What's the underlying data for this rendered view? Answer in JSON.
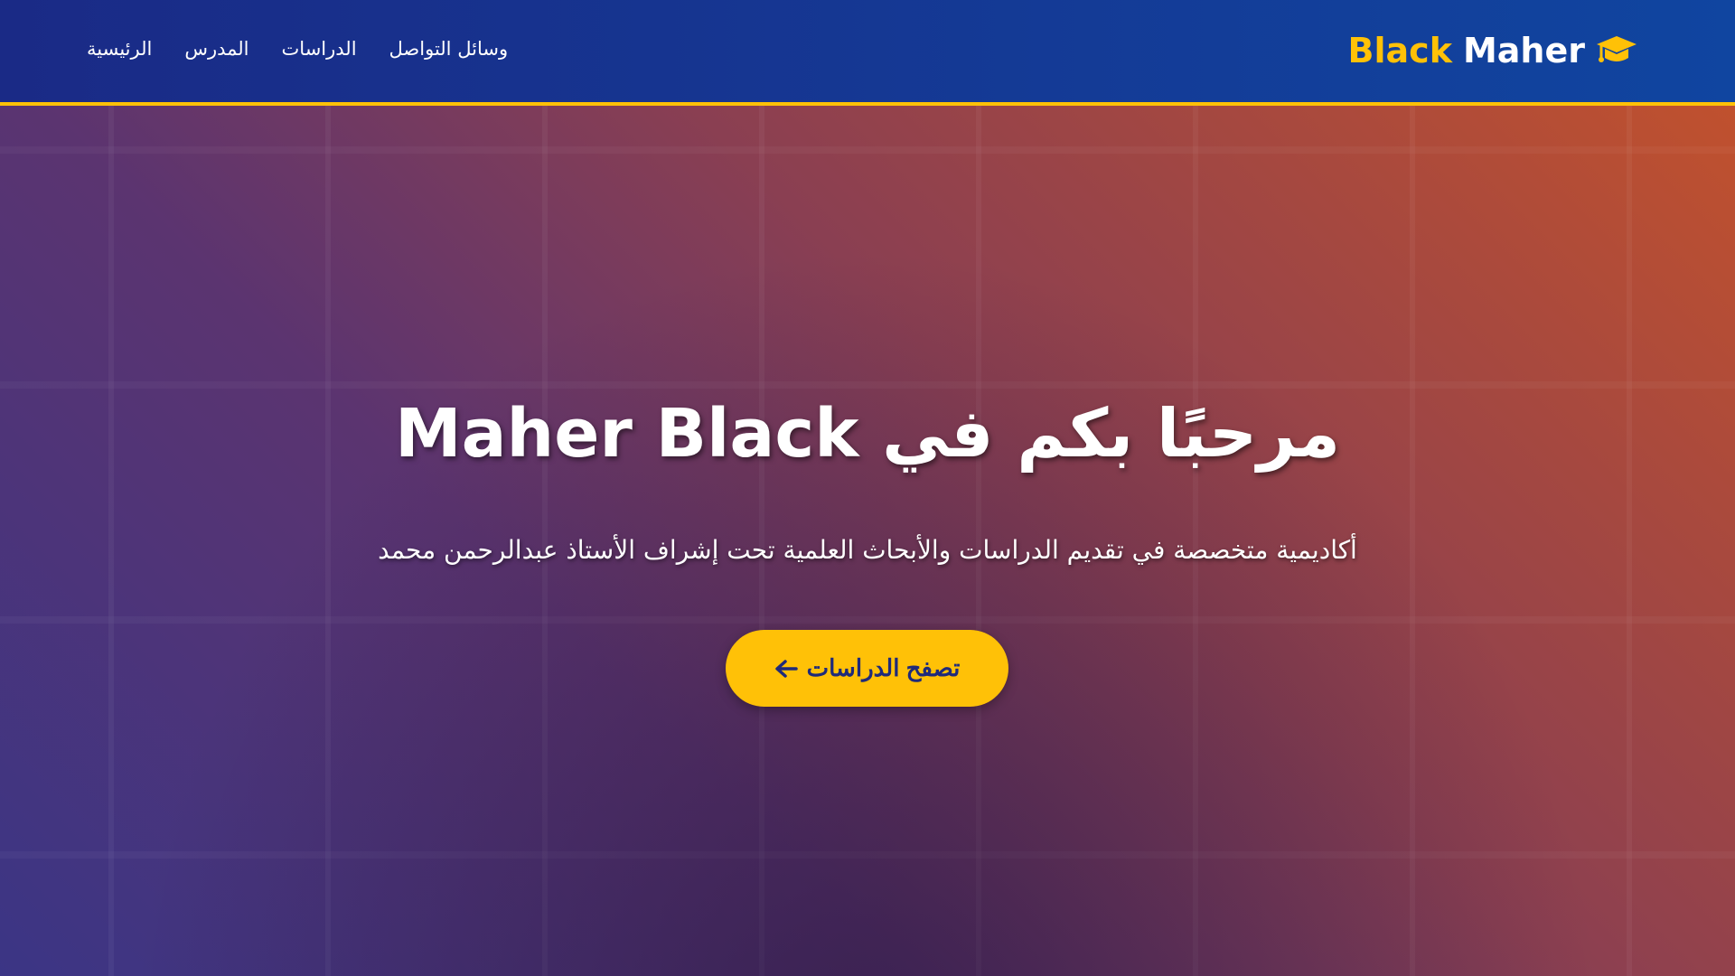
{
  "header": {
    "logo": {
      "part1": "Black",
      "part2": "Maher",
      "icon": "graduation-cap-icon"
    },
    "nav": [
      {
        "label": "الرئيسية"
      },
      {
        "label": "المدرس"
      },
      {
        "label": "الدراسات"
      },
      {
        "label": "وسائل التواصل"
      }
    ]
  },
  "hero": {
    "title": "مرحبًا بكم في Maher Black",
    "subtitle": "أكاديمية متخصصة في تقديم الدراسات والأبحاث العلمية تحت إشراف الأستاذ عبدالرحمن محمد",
    "cta": "تصفح الدراسات",
    "cta_icon": "arrow-left-icon"
  },
  "colors": {
    "accent": "#ffc107",
    "header": "#1a3a96",
    "button_text": "#1f2a7a"
  }
}
